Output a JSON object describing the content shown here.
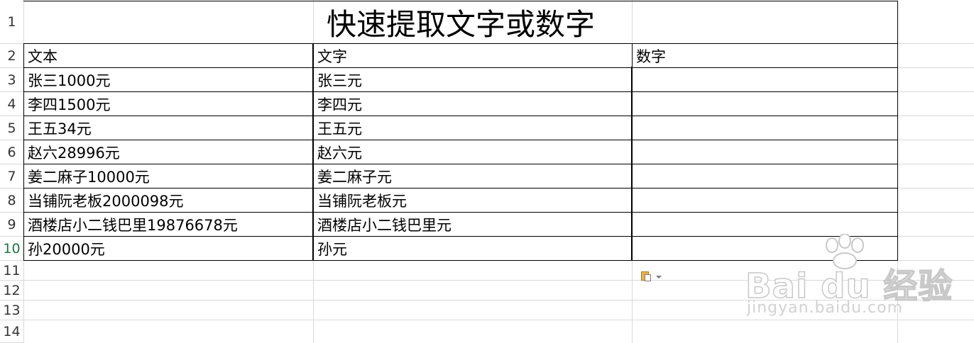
{
  "sheet": {
    "title": "快速提取文字或数字",
    "row_numbers": [
      "1",
      "2",
      "3",
      "4",
      "5",
      "6",
      "7",
      "8",
      "9",
      "10",
      "11",
      "12",
      "13",
      "14"
    ],
    "headers": {
      "col_a": "文本",
      "col_b": "文字",
      "col_c": "数字"
    },
    "rows": [
      {
        "a": "张三1000元",
        "b": "张三元",
        "c": ""
      },
      {
        "a": "李四1500元",
        "b": "李四元",
        "c": ""
      },
      {
        "a": "王五34元",
        "b": "王五元",
        "c": ""
      },
      {
        "a": "赵六28996元",
        "b": "赵六元",
        "c": ""
      },
      {
        "a": "姜二麻子10000元",
        "b": "姜二麻子元",
        "c": ""
      },
      {
        "a": "当铺阮老板2000098元",
        "b": "当铺阮老板元",
        "c": ""
      },
      {
        "a": "酒楼店小二钱巴里19876678元",
        "b": "酒楼店小二钱巴里元",
        "c": ""
      },
      {
        "a": "孙20000元",
        "b": "孙元",
        "c": ""
      }
    ]
  },
  "paste_options": {
    "icon": "paste-options-icon"
  },
  "watermark": {
    "brand": "Bai du 经验",
    "url": "jingyan.baidu.com"
  },
  "colors": {
    "active_row_header": "#217346",
    "grid": "#d9d9d9",
    "border": "#000000"
  }
}
